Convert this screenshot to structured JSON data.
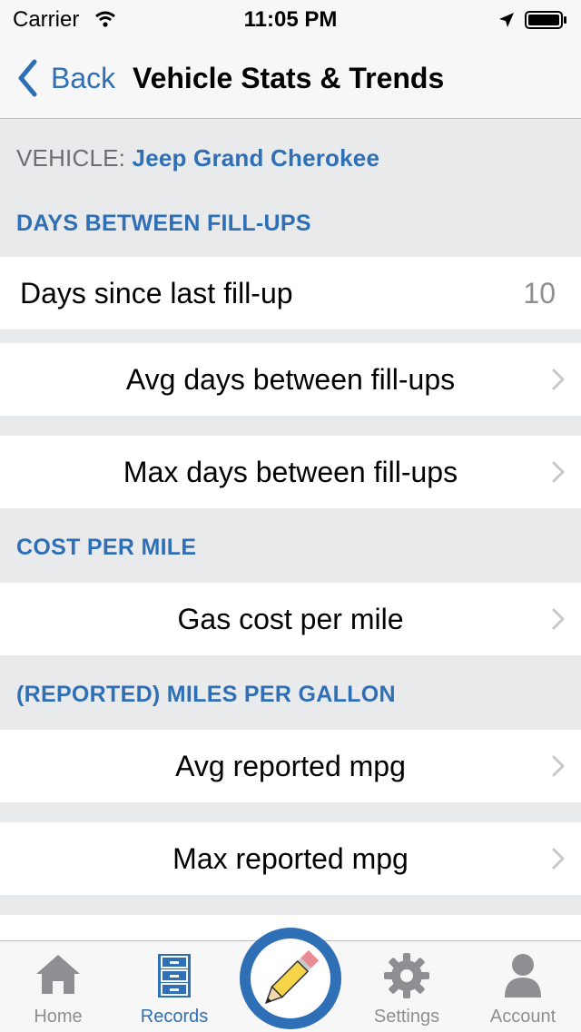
{
  "status_bar": {
    "carrier": "Carrier",
    "time": "11:05 PM"
  },
  "nav": {
    "back_label": "Back",
    "title": "Vehicle Stats & Trends"
  },
  "vehicle": {
    "label": "VEHICLE:",
    "name": "Jeep Grand Cherokee"
  },
  "sections": {
    "days": {
      "header": "DAYS BETWEEN FILL-UPS",
      "since_label": "Days since last fill-up",
      "since_value": "10",
      "avg_label": "Avg days between fill-ups",
      "max_label": "Max days between fill-ups"
    },
    "cost": {
      "header": "COST PER MILE",
      "gas_label": "Gas cost per mile"
    },
    "mpg": {
      "header": "(REPORTED) MILES PER GALLON",
      "avg_label": "Avg reported mpg",
      "max_label": "Max reported mpg"
    }
  },
  "tabbar": {
    "home": "Home",
    "records": "Records",
    "settings": "Settings",
    "account": "Account"
  },
  "colors": {
    "accent": "#2f6fb5",
    "background": "#e9eaec",
    "secondary_text": "#8e8e93",
    "pencil": "#f5d547"
  }
}
